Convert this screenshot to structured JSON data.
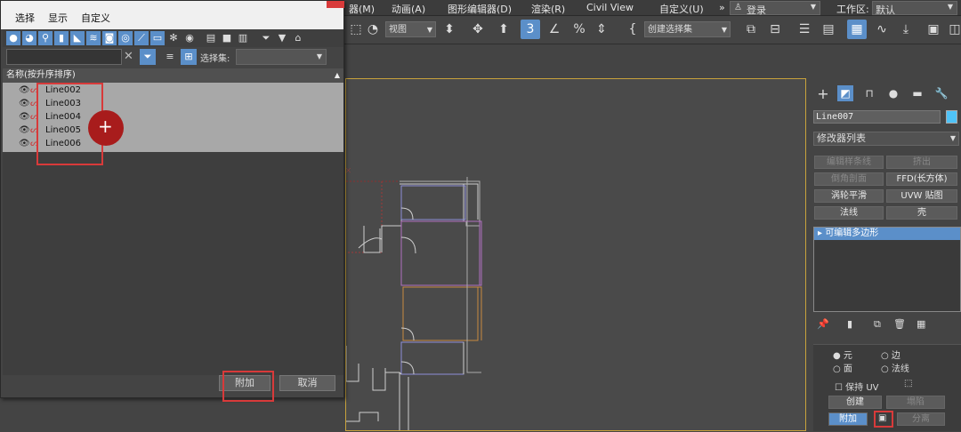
{
  "menu": {
    "items": [
      "器(M)",
      "动画(A)",
      "图形编辑器(D)",
      "渲染(R)",
      "Civil View",
      "自定义(U)"
    ],
    "overflow": "»",
    "login_label": "登录",
    "workspace_label": "工作区:",
    "workspace_value": "默认"
  },
  "toolbar": {
    "view_dropdown": "视图",
    "selection_set_dropdown": "创建选择集"
  },
  "scene_explorer": {
    "menu": [
      "选择",
      "显示",
      "自定义"
    ],
    "search_placeholder": "",
    "selection_set_label": "选择集:",
    "selection_set_value": "",
    "column_header": "名称(按升序排序)",
    "items": [
      "Line002",
      "Line003",
      "Line004",
      "Line005",
      "Line006"
    ],
    "ok_button": "附加",
    "cancel_button": "取消"
  },
  "command_panel": {
    "object_name": "Line007",
    "object_color": "#4fc3f7",
    "modifier_list": "修改器列表",
    "modifier_buttons": [
      "编辑样条线",
      "挤出",
      "倒角剖面",
      "FFD(长方体)",
      "涡轮平滑",
      "UVW 贴图",
      "法线",
      "壳"
    ],
    "stack_item": "可编辑多边形",
    "bottom": {
      "radio_1": "元",
      "radio_2": "边",
      "radio_3": "面",
      "radio_4": "法线",
      "keep_uv": "保持 UV",
      "create_btn": "创建",
      "collapse_btn": "塌陷",
      "attach_btn": "附加",
      "detach_btn": "分离"
    }
  },
  "colors": {
    "accent": "#5b8fc9",
    "highlight_box": "#d83a3a",
    "viewport_border": "#c8a23c"
  }
}
